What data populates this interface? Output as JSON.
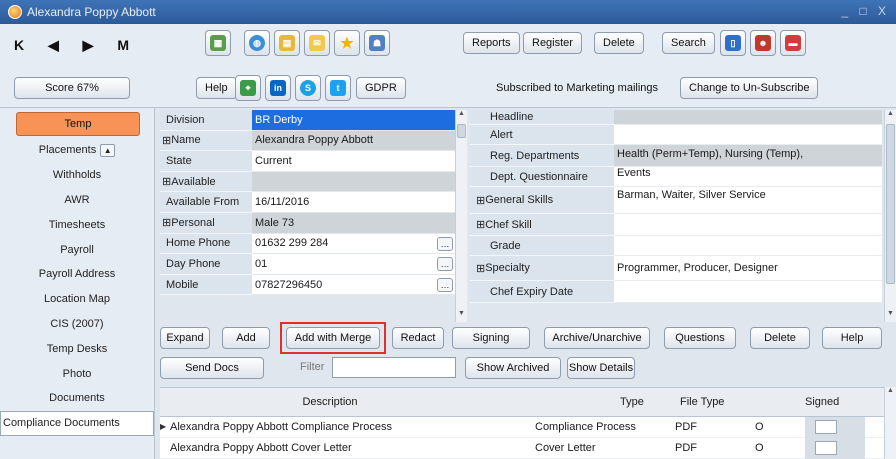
{
  "window": {
    "title": "Alexandra Poppy Abbott",
    "controls": "_ □ X"
  },
  "toolbar": {
    "nav": "K ◀ ▶ M",
    "score": "Score 67%",
    "help": "Help",
    "gdpr": "GDPR",
    "reports": "Reports",
    "register": "Register",
    "delete": "Delete",
    "search": "Search",
    "subscribed_text": "Subscribed to Marketing mailings",
    "change_subscribe": "Change to Un-Subscribe"
  },
  "sidebar": {
    "items": [
      "Temp",
      "Placements",
      "Withholds",
      "AWR",
      "Timesheets",
      "Payroll",
      "Payroll Address",
      "Location Map",
      "CIS (2007)",
      "Temp Desks",
      "Photo",
      "Documents",
      "Compliance Documents"
    ]
  },
  "details_left": [
    {
      "label": "Division",
      "value": "BR Derby"
    },
    {
      "label": "Name",
      "value": "Alexandra Poppy Abbott"
    },
    {
      "label": "State",
      "value": "Current"
    },
    {
      "label": "Available",
      "value": ""
    },
    {
      "label": "Available From",
      "value": "16/11/2016"
    },
    {
      "label": "Personal",
      "value": "Male 73"
    },
    {
      "label": "Home Phone",
      "value": "01632 299 284"
    },
    {
      "label": "Day Phone",
      "value": "01"
    },
    {
      "label": "Mobile",
      "value": "07827296450"
    }
  ],
  "details_right": [
    {
      "label": "Headline",
      "value": ""
    },
    {
      "label": "Alert",
      "value": ""
    },
    {
      "label": "Reg. Departments",
      "value": "Health (Perm+Temp), Nursing (Temp),"
    },
    {
      "label": "Dept. Questionnaire",
      "value": "Events"
    },
    {
      "label": "General Skills",
      "value": "Barman, Waiter, Silver Service"
    },
    {
      "label": "Chef Skill",
      "value": ""
    },
    {
      "label": "Grade",
      "value": ""
    },
    {
      "label": "Specialty",
      "value": "Programmer, Producer, Designer"
    },
    {
      "label": "Chef Expiry Date",
      "value": ""
    }
  ],
  "actions": {
    "expand": "Expand",
    "add": "Add",
    "add_with_merge": "Add with Merge",
    "redact": "Redact",
    "signing": "Signing",
    "archive": "Archive/Unarchive",
    "questions": "Questions",
    "delete": "Delete",
    "help": "Help",
    "send_docs": "Send Docs",
    "filter_label": "Filter",
    "filter_value": "",
    "show_archived": "Show Archived",
    "show_details": "Show Details"
  },
  "documents_table": {
    "headers": [
      "Description",
      "Type",
      "File Type",
      "Signed"
    ],
    "rows": [
      {
        "description": "Alexandra Poppy Abbott Compliance Process",
        "type": "Compliance Process",
        "file_type": "PDF",
        "o": "O"
      },
      {
        "description": "Alexandra Poppy Abbott Cover Letter",
        "type": "Cover Letter",
        "file_type": "PDF",
        "o": "O"
      }
    ]
  },
  "colors": {
    "active_tab": "#f79356",
    "selected_cell": "#1e6de0",
    "highlight": "#e0302a"
  }
}
